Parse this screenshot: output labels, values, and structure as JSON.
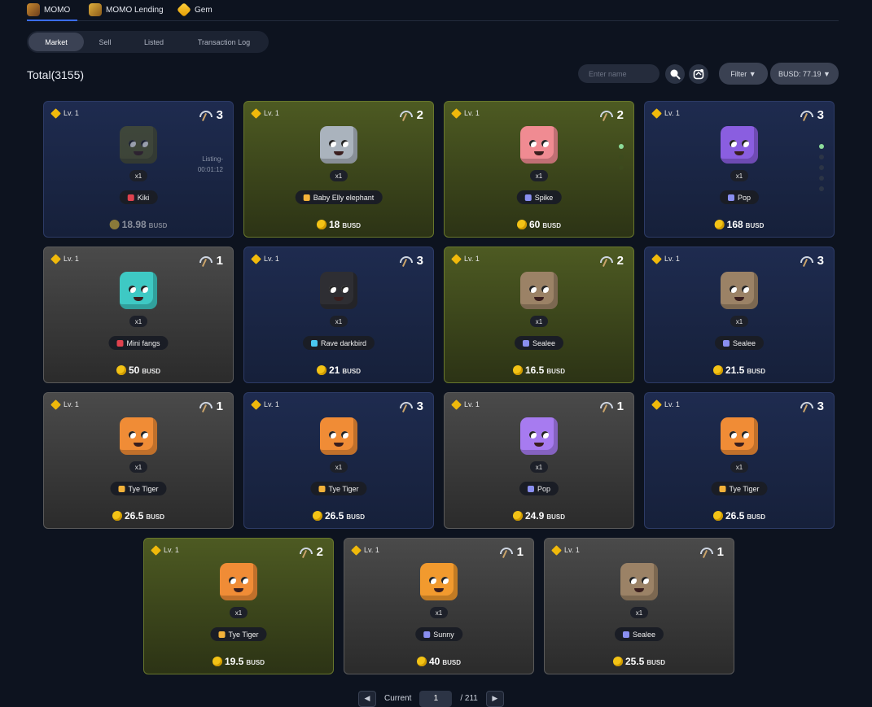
{
  "top_tabs": [
    {
      "label": "MOMO",
      "icon": "momo-icon"
    },
    {
      "label": "MOMO Lending",
      "icon": "lending-icon"
    },
    {
      "label": "Gem",
      "icon": "gem-icon"
    }
  ],
  "sub_tabs": [
    "Market",
    "Sell",
    "Listed",
    "Transaction Log"
  ],
  "total_label": "Total(3155)",
  "search": {
    "placeholder": "Enter name"
  },
  "filter_label": "Filter ▼",
  "balance_label": "BUSD: 77.19 ▼",
  "currency": "BUSD",
  "cards": [
    {
      "level": "Lv. 1",
      "hash": "3",
      "qty": "x1",
      "name": "Kiki",
      "price": "18.98",
      "listing": "Listing-",
      "listing_time": "00:01:12",
      "theme": "blue",
      "pet_color": "#5a5e2e",
      "tag_color": "#e0424e"
    },
    {
      "level": "Lv. 1",
      "hash": "2",
      "qty": "x1",
      "name": "Baby Elly elephant",
      "price": "18",
      "theme": "green",
      "pet_color": "#aab3bd",
      "tag_color": "#f3b23a"
    },
    {
      "level": "Lv. 1",
      "hash": "2",
      "qty": "x1",
      "name": "Spike",
      "price": "60",
      "theme": "green",
      "pet_color": "#f08b92",
      "tag_color": "#8a8ff0"
    },
    {
      "level": "Lv. 1",
      "hash": "3",
      "qty": "x1",
      "name": "Pop",
      "price": "168",
      "theme": "blue",
      "pet_color": "#8a5ee0",
      "tag_color": "#8a8ff0"
    },
    {
      "level": "Lv. 1",
      "hash": "1",
      "qty": "x1",
      "name": "Mini fangs",
      "price": "50",
      "theme": "gray",
      "pet_color": "#3ec9c4",
      "tag_color": "#e0424e"
    },
    {
      "level": "Lv. 1",
      "hash": "3",
      "qty": "x1",
      "name": "Rave darkbird",
      "price": "21",
      "theme": "blue",
      "pet_color": "#2e2e33",
      "tag_color": "#4ac8f0"
    },
    {
      "level": "Lv. 1",
      "hash": "2",
      "qty": "x1",
      "name": "Sealee",
      "price": "16.5",
      "theme": "green",
      "pet_color": "#9b8266",
      "tag_color": "#8a8ff0"
    },
    {
      "level": "Lv. 1",
      "hash": "3",
      "qty": "x1",
      "name": "Sealee",
      "price": "21.5",
      "theme": "blue",
      "pet_color": "#9b8266",
      "tag_color": "#8a8ff0"
    },
    {
      "level": "Lv. 1",
      "hash": "1",
      "qty": "x1",
      "name": "Tye Tiger",
      "price": "26.5",
      "theme": "gray",
      "pet_color": "#f08c36",
      "tag_color": "#f3b23a"
    },
    {
      "level": "Lv. 1",
      "hash": "3",
      "qty": "x1",
      "name": "Tye Tiger",
      "price": "26.5",
      "theme": "blue",
      "pet_color": "#f08c36",
      "tag_color": "#f3b23a"
    },
    {
      "level": "Lv. 1",
      "hash": "1",
      "qty": "x1",
      "name": "Pop",
      "price": "24.9",
      "theme": "gray",
      "pet_color": "#a77bf0",
      "tag_color": "#8a8ff0"
    },
    {
      "level": "Lv. 1",
      "hash": "3",
      "qty": "x1",
      "name": "Tye Tiger",
      "price": "26.5",
      "theme": "blue",
      "pet_color": "#f08c36",
      "tag_color": "#f3b23a"
    },
    {
      "level": "Lv. 1",
      "hash": "2",
      "qty": "x1",
      "name": "Tye Tiger",
      "price": "19.5",
      "theme": "green",
      "pet_color": "#f08c36",
      "tag_color": "#f3b23a"
    },
    {
      "level": "Lv. 1",
      "hash": "1",
      "qty": "x1",
      "name": "Sunny",
      "price": "40",
      "theme": "gray",
      "pet_color": "#f29a2e",
      "tag_color": "#8a8ff0"
    },
    {
      "level": "Lv. 1",
      "hash": "1",
      "qty": "x1",
      "name": "Sealee",
      "price": "25.5",
      "theme": "gray",
      "pet_color": "#9b8266",
      "tag_color": "#8a8ff0"
    }
  ],
  "pagination": {
    "current_label": "Current",
    "current_page": "1",
    "total_pages": "/ 211"
  }
}
